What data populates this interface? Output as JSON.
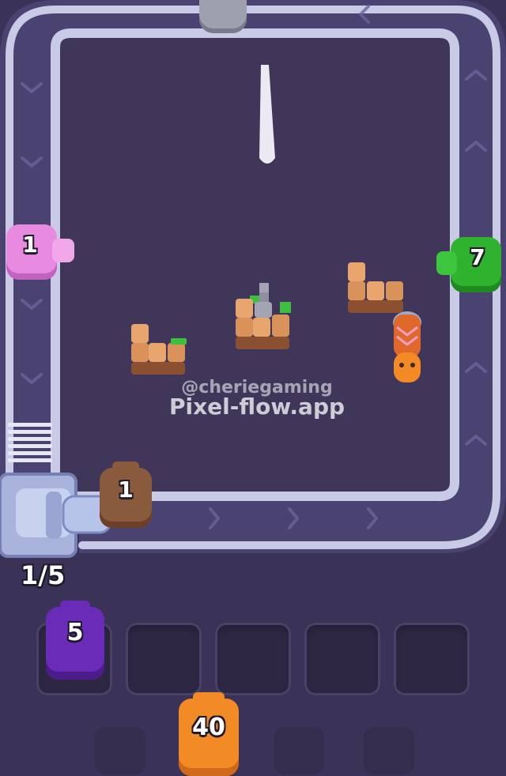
{
  "game": {
    "conveyor_count": "1/5",
    "watermark_handle": "@cheriegaming",
    "watermark_site": "Pixel-flow.app"
  },
  "shooters": {
    "pink": {
      "ammo": "1",
      "color": "#e88be0"
    },
    "green": {
      "ammo": "7",
      "color": "#2fb32f"
    },
    "brown": {
      "ammo": "1",
      "color": "#8a5a3c"
    },
    "purple": {
      "ammo": "5",
      "color": "#6a2bb8"
    },
    "orange": {
      "ammo": "40",
      "color": "#f28a26"
    }
  },
  "colors": {
    "board": "#3f3659",
    "track": "#4a4270",
    "track_border": "#c9cbe6",
    "wood": "#d9935a",
    "grass": "#3fbf3f",
    "stone": "#9b9bab"
  }
}
